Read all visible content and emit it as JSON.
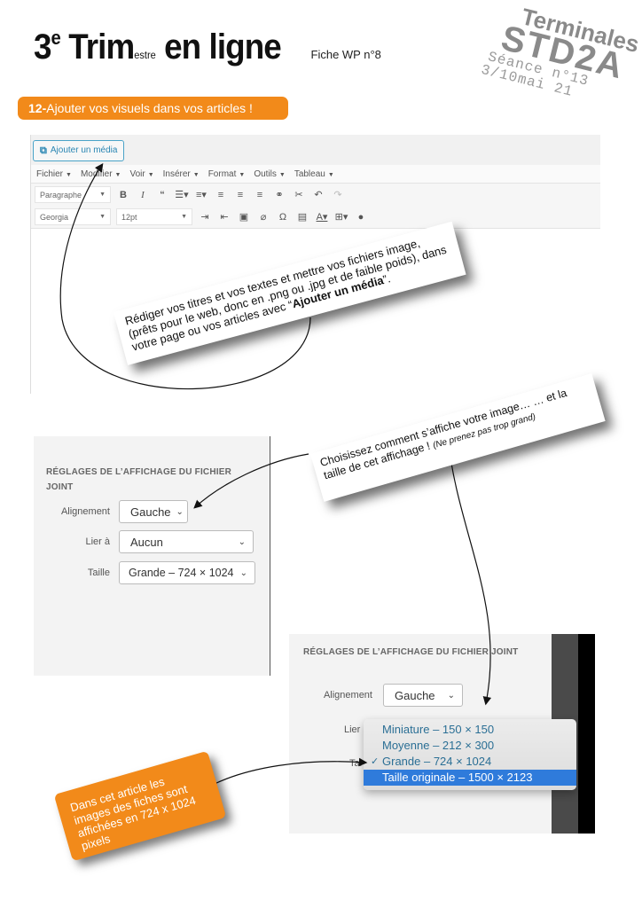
{
  "header": {
    "title_part1": "3",
    "title_sup": "e",
    "title_part2": "Trim",
    "title_small": "estre",
    "title_part3": "en ligne",
    "fiche": "Fiche WP n°8"
  },
  "stamp": {
    "line1": "Terminales",
    "line2": "STD2A",
    "line3": "Séance n°13",
    "line4": "3/10mai 21"
  },
  "banner": {
    "number": "12-",
    "text_a": "Ajouter vos visuels ",
    "text_b": "dans",
    "text_c": " vos articles !"
  },
  "colors": {
    "accent_orange": "#f28a1a",
    "highlight_blue": "#2f7bdb",
    "wp_blue": "#2a86b3"
  },
  "editor": {
    "add_media_label": "Ajouter un média",
    "add_media_icon": "media-icon",
    "menu": [
      {
        "label": "Fichier"
      },
      {
        "label": "Modifier"
      },
      {
        "label": "Voir"
      },
      {
        "label": "Insérer"
      },
      {
        "label": "Format"
      },
      {
        "label": "Outils"
      },
      {
        "label": "Tableau"
      }
    ],
    "format_select": "Paragraphe",
    "font_select": "Georgia",
    "size_select": "12pt",
    "toolbar1_icons": [
      "bold-icon",
      "italic-icon",
      "blockquote-icon",
      "bullet-list-icon",
      "numbered-list-icon",
      "align-left-icon",
      "align-center-icon",
      "align-right-icon",
      "link-icon",
      "unlink-icon",
      "undo-icon",
      "redo-icon"
    ],
    "toolbar2_icons": [
      "indent-icon",
      "outdent-icon",
      "paste-text-icon",
      "clear-format-icon",
      "special-char-icon",
      "more-tag-icon",
      "text-color-icon",
      "table-icon",
      "help-icon"
    ]
  },
  "notes": {
    "note1_a": "Rédiger vos titres et vos textes et mettre vos fichiers image, (prêts pour le web, donc en .png ou .jpg et de faible poids), dans votre page ou vos articles avec “",
    "note1_bold": "Ajouter un média",
    "note1_end": "”.",
    "note2_a": "Choisissez comment s’affiche votre image… … et la taille de cet affichage ! ",
    "note2_italic": "(Ne prenez pas trop grand)",
    "note3": "Dans cet article les images des fiches sont affichées en 724 x 1024 pixels"
  },
  "panel1": {
    "title": "RÉGLAGES DE L’AFFICHAGE DU FICHIER JOINT",
    "align_label": "Alignement",
    "align_value": "Gauche",
    "link_label": "Lier à",
    "link_value": "Aucun",
    "size_label": "Taille",
    "size_value": "Grande – 724 × 1024"
  },
  "panel2": {
    "title": "RÉGLAGES DE L’AFFICHAGE DU FICHIER JOINT",
    "align_label": "Alignement",
    "align_value": "Gauche",
    "link_label": "Lier",
    "size_label": "Tai",
    "options": [
      {
        "label": "Miniature – 150 × 150",
        "checked": false,
        "highlighted": false
      },
      {
        "label": "Moyenne – 212 × 300",
        "checked": false,
        "highlighted": false
      },
      {
        "label": "Grande – 724 × 1024",
        "checked": true,
        "highlighted": false
      },
      {
        "label": "Taille originale – 1500 × 2123",
        "checked": false,
        "highlighted": true
      }
    ],
    "check_glyph": "✓"
  }
}
